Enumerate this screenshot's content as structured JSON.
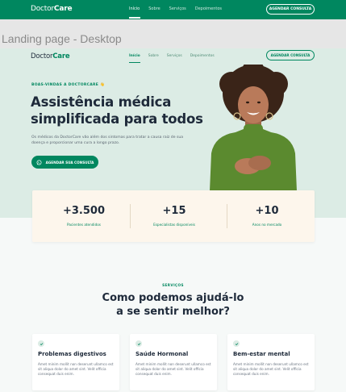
{
  "top_nav": {
    "logo_prefix": "Doctor",
    "logo_suffix": "Care",
    "links": [
      "Início",
      "Sobre",
      "Serviços",
      "Depoimentos"
    ],
    "cta": "AGENDAR CONSULTA"
  },
  "frame_label": "Landing page - Desktop",
  "landing": {
    "nav": {
      "logo_prefix": "Doctor",
      "logo_suffix": "Care",
      "links": [
        "Início",
        "Sobre",
        "Serviços",
        "Depoimentos"
      ],
      "cta": "AGENDAR CONSULTA"
    },
    "hero": {
      "eyebrow": "BOAS-VINDAS A DOCTORCARE",
      "eyebrow_emoji": "👋",
      "title_line1": "Assistência médica",
      "title_line2": "simplificada para todos",
      "lead": "Os médicos da DoctorCare vão além dos sintomas para tratar a causa raiz de sua doença e proporcionar uma cura a longo prazo.",
      "cta": "AGENDAR SUA CONSULTA",
      "cta_icon": "whatsapp-icon"
    },
    "stats": [
      {
        "number": "+3.500",
        "label": "Pacientes atendidos"
      },
      {
        "number": "+15",
        "label": "Especialistas disponíveis"
      },
      {
        "number": "+10",
        "label": "Anos no mercado"
      }
    ],
    "services": {
      "eyebrow": "SERVIÇOS",
      "title_line1": "Como podemos ajudá-lo",
      "title_line2": "a se sentir melhor?",
      "cards": [
        {
          "title": "Problemas digestivos",
          "body": "Amet minim mollit non deserunt ullamco est sit aliqua dolor do amet sint. Velit officia consequat duis enim."
        },
        {
          "title": "Saúde Hormonal",
          "body": "Amet minim mollit non deserunt ullamco est sit aliqua dolor do amet sint. Velit officia consequat duis enim."
        },
        {
          "title": "Bem-estar mental",
          "body": "Amet minim mollit non deserunt ullamco est sit aliqua dolor do amet sint. Velit officia consequat duis enim."
        }
      ]
    }
  },
  "colors": {
    "brand_green": "#00875f",
    "hero_bg": "#dcece5",
    "heading": "#1e2a3a",
    "stats_bg": "#fdf6ec"
  }
}
